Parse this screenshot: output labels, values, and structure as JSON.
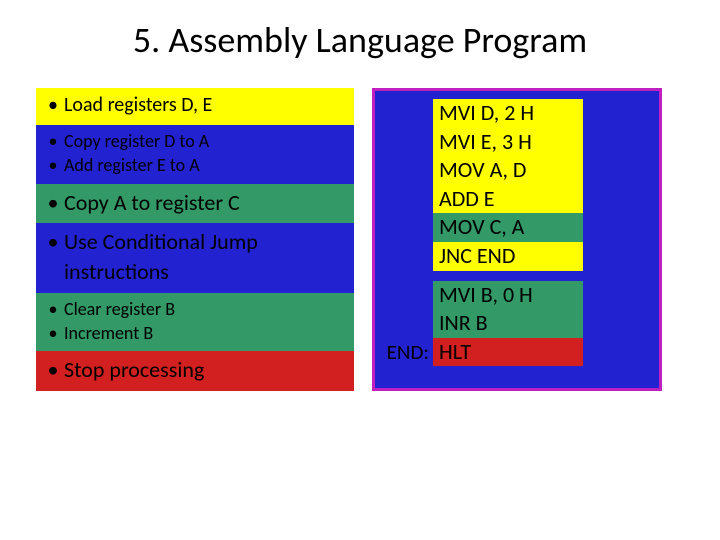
{
  "title": "5. Assembly Language Program",
  "left": {
    "load": "Load registers D, E",
    "copyD": "Copy register D to A",
    "addE": "Add register E to A",
    "copyA": "Copy A to register C",
    "jump1": "Use Conditional Jump",
    "jump2": "instructions",
    "clearB": "Clear register B",
    "incB": "Increment B",
    "stop": "Stop processing"
  },
  "code": {
    "mviD": "MVI D, 2 H",
    "mviE": "MVI E, 3 H",
    "movAD": "MOV A, D",
    "addE": "ADD E",
    "movCA": "MOV C, A",
    "jnc": "JNC END",
    "mviB": "MVI B, 0 H",
    "inrB": "INR B",
    "endLabel": "END:",
    "hlt": "HLT"
  },
  "bullet": "•"
}
